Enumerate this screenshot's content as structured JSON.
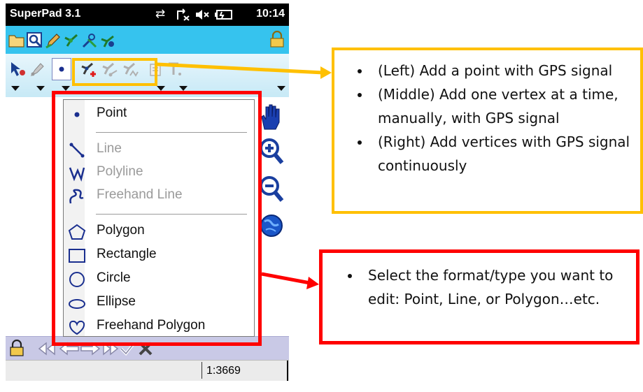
{
  "status_bar": {
    "app_title": "SuperPad 3.1",
    "clock": "10:14",
    "icons": [
      "connectivity-icon",
      "signal-off-icon",
      "volume-muted-icon",
      "battery-icon"
    ]
  },
  "toolbar1": {
    "icons": [
      "open-folder-icon",
      "zoom-extent-icon",
      "edit-pencil-icon",
      "gps-satellite-icon",
      "tools-icon",
      "gps-settings-icon",
      "lock-icon"
    ]
  },
  "toolbar2": {
    "icons": [
      "select-arrow-icon",
      "edit-vertex-icon",
      "point-mode-icon",
      "gps-add-point-icon",
      "gps-add-vertex-icon",
      "gps-stream-vertices-icon",
      "attribute-icon",
      "text-icon"
    ]
  },
  "shape_menu": {
    "items": [
      {
        "label": "Point",
        "icon": "point-icon",
        "enabled": true
      },
      {
        "label": "Line",
        "icon": "line-icon",
        "enabled": false
      },
      {
        "label": "Polyline",
        "icon": "polyline-icon",
        "enabled": false
      },
      {
        "label": "Freehand Line",
        "icon": "freehand-line-icon",
        "enabled": false
      },
      {
        "label": "Polygon",
        "icon": "polygon-icon",
        "enabled": true
      },
      {
        "label": "Rectangle",
        "icon": "rectangle-icon",
        "enabled": true
      },
      {
        "label": "Circle",
        "icon": "circle-icon",
        "enabled": true
      },
      {
        "label": "Ellipse",
        "icon": "ellipse-icon",
        "enabled": true
      },
      {
        "label": "Freehand Polygon",
        "icon": "freehand-polygon-icon",
        "enabled": true
      }
    ]
  },
  "map_tools": [
    "pan-hand-icon",
    "zoom-in-icon",
    "zoom-out-icon",
    "globe-icon"
  ],
  "bottom_status": {
    "scale": "1:3669"
  },
  "callouts": {
    "gps_tools": [
      "(Left) Add a point with GPS signal",
      "(Middle) Add one vertex at a time, manually, with GPS signal",
      "(Right) Add vertices with GPS signal continuously"
    ],
    "shape_menu": [
      "Select the format/type you want to edit: Point, Line, or Polygon…etc."
    ]
  },
  "colors": {
    "toolbar_blue": "#36c3ee",
    "callout_yellow": "#ffc000",
    "callout_red": "#ff0000",
    "bottom_bar": "#c9c9e6"
  }
}
